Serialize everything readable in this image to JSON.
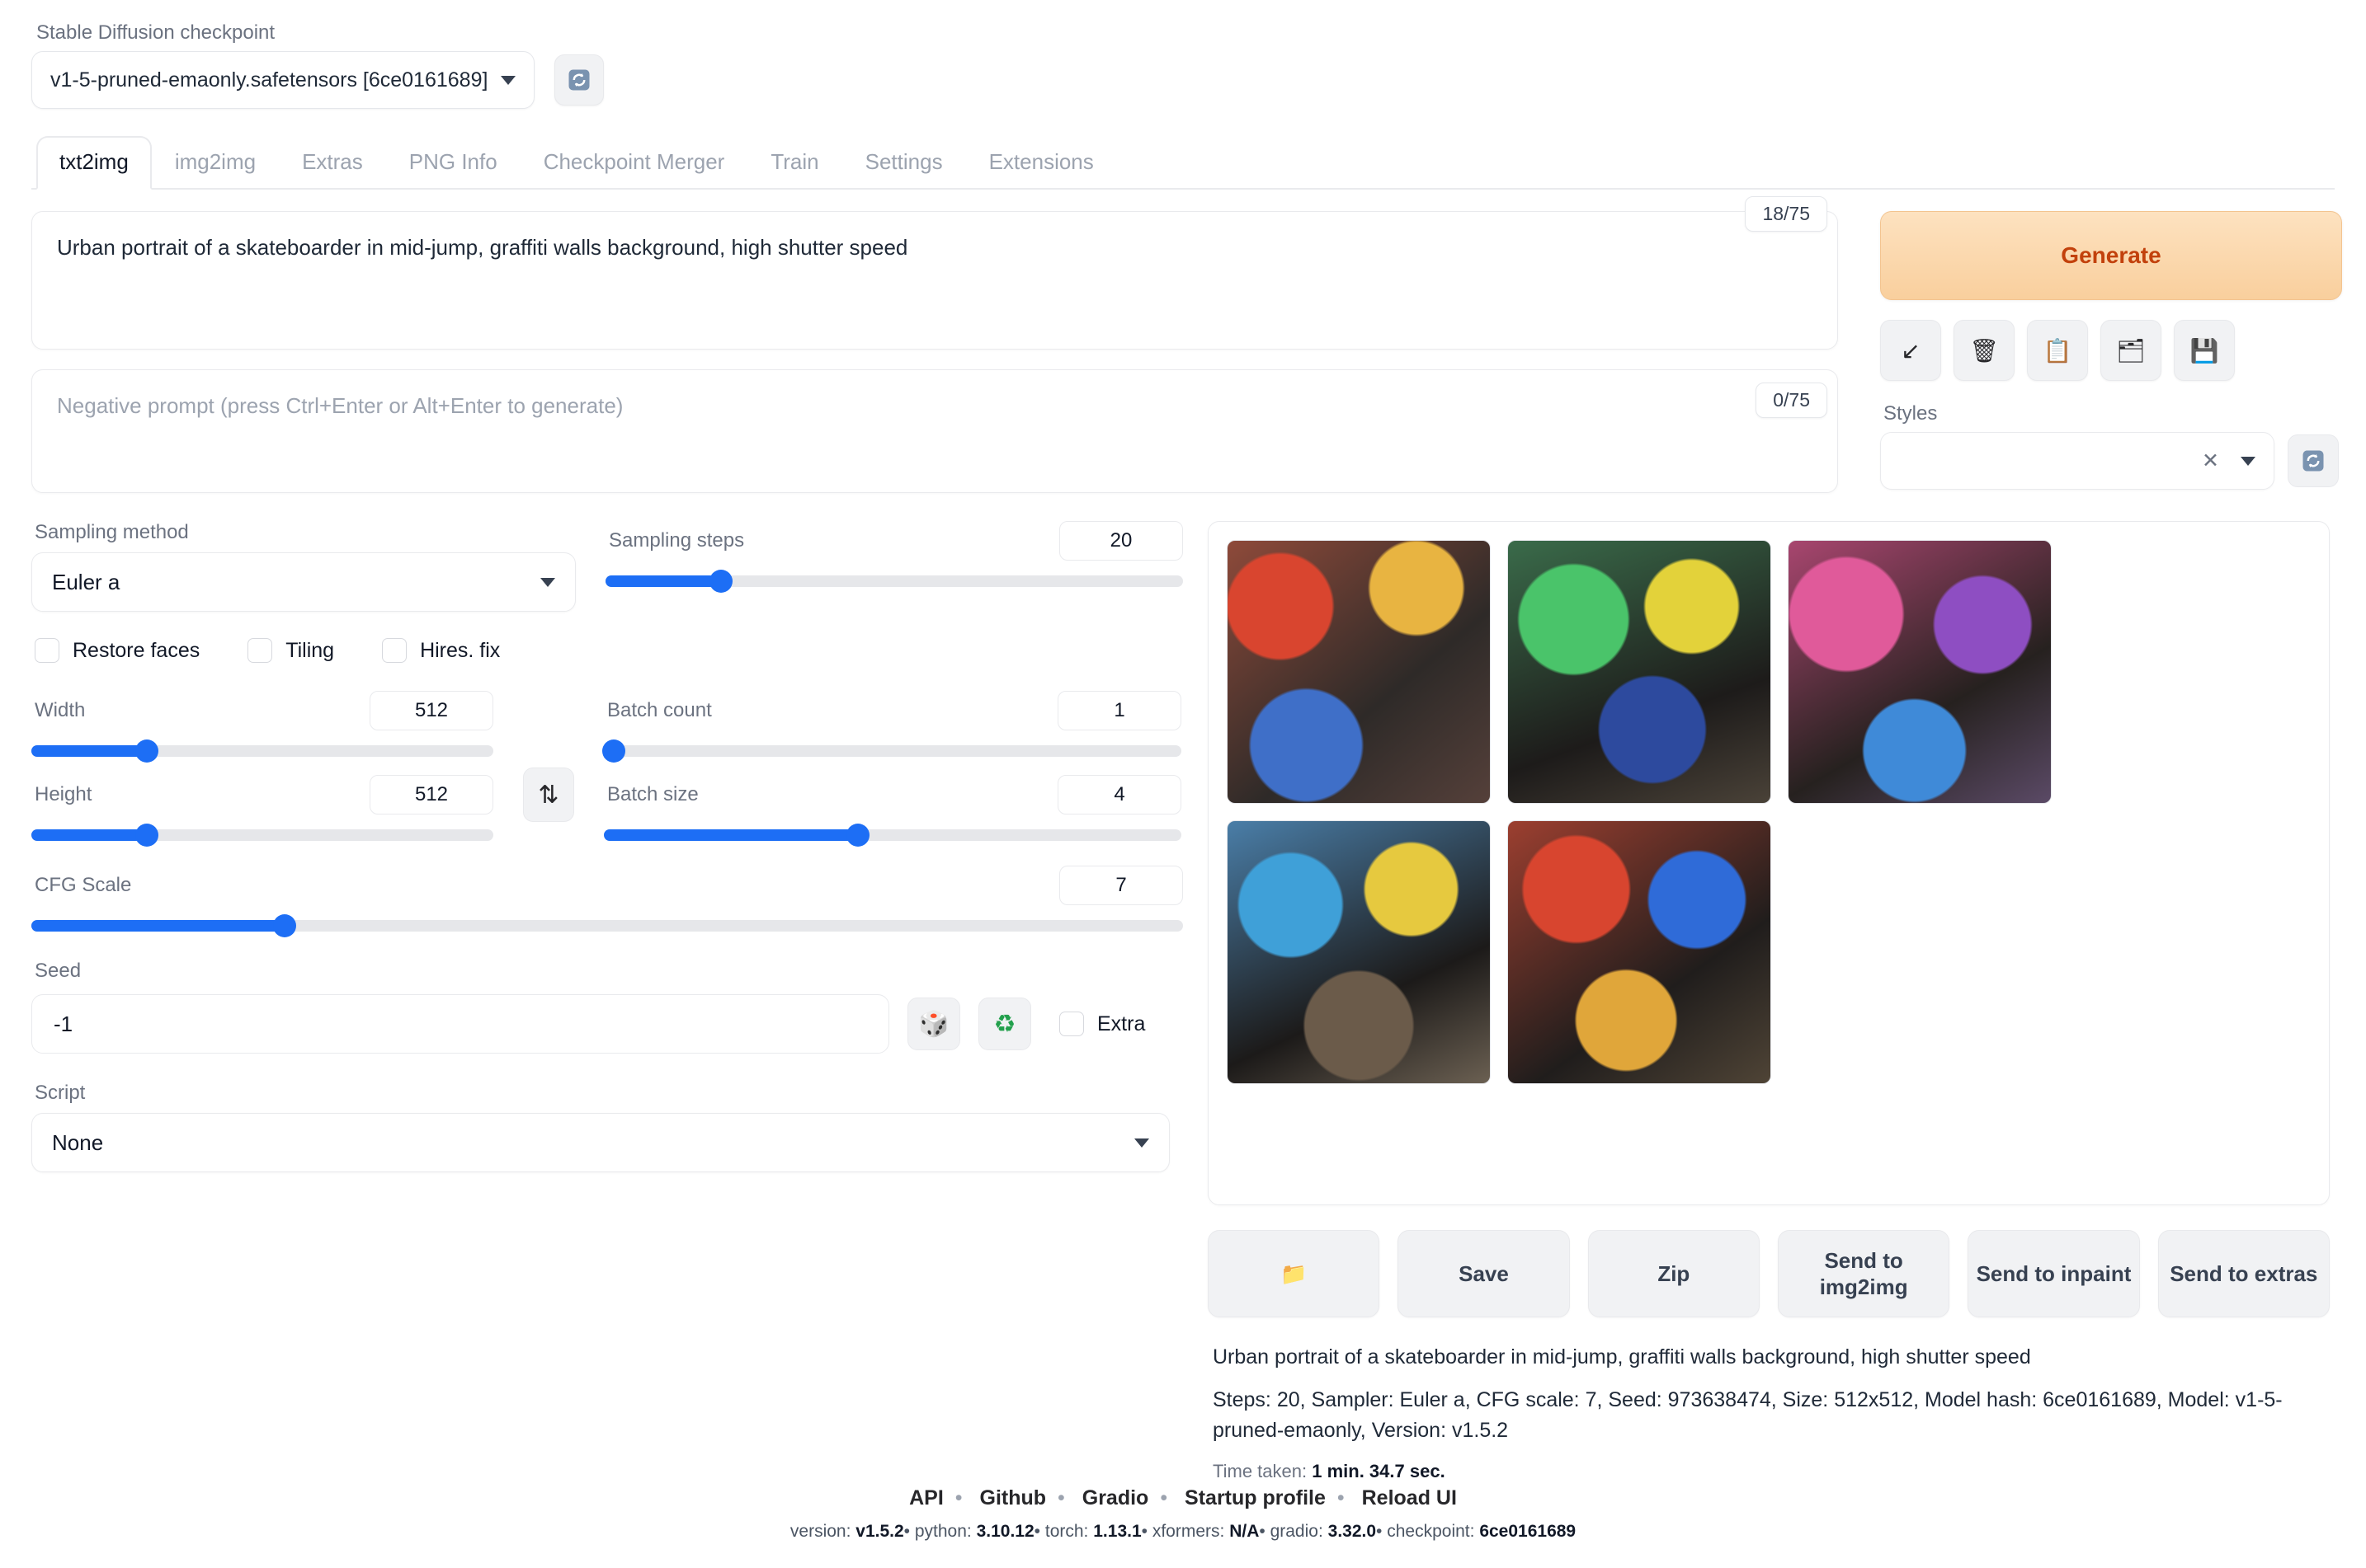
{
  "checkpoint": {
    "label": "Stable Diffusion checkpoint",
    "value": "v1-5-pruned-emaonly.safetensors [6ce0161689]",
    "refresh_icon": "refresh-icon"
  },
  "tabs": [
    {
      "label": "txt2img",
      "active": true
    },
    {
      "label": "img2img",
      "active": false
    },
    {
      "label": "Extras",
      "active": false
    },
    {
      "label": "PNG Info",
      "active": false
    },
    {
      "label": "Checkpoint Merger",
      "active": false
    },
    {
      "label": "Train",
      "active": false
    },
    {
      "label": "Settings",
      "active": false
    },
    {
      "label": "Extensions",
      "active": false
    }
  ],
  "prompt": {
    "value": "Urban portrait of a skateboarder in mid-jump, graffiti walls background, high shutter speed",
    "token_count": "18/75"
  },
  "negative_prompt": {
    "placeholder": "Negative prompt (press Ctrl+Enter or Alt+Enter to generate)",
    "value": "",
    "token_count": "0/75"
  },
  "generate": {
    "label": "Generate",
    "tools": [
      {
        "name": "arrow-down-left-icon",
        "glyph": "↙"
      },
      {
        "name": "trash-icon",
        "glyph": "🗑"
      },
      {
        "name": "paste-icon",
        "glyph": "📋"
      },
      {
        "name": "card-icon",
        "glyph": "🗂"
      },
      {
        "name": "save-style-icon",
        "glyph": "💾"
      }
    ]
  },
  "styles": {
    "label": "Styles",
    "value": "",
    "clear_glyph": "✕",
    "refresh_icon": "refresh-icon"
  },
  "sampling": {
    "method_label": "Sampling method",
    "method_value": "Euler a",
    "steps_label": "Sampling steps",
    "steps_value": "20",
    "steps_percent": 20
  },
  "toggles": [
    {
      "label": "Restore faces",
      "checked": false
    },
    {
      "label": "Tiling",
      "checked": false
    },
    {
      "label": "Hires. fix",
      "checked": false
    }
  ],
  "dimensions": {
    "width_label": "Width",
    "width_value": "512",
    "width_percent": 25,
    "height_label": "Height",
    "height_value": "512",
    "height_percent": 25,
    "swap_glyph": "⇅"
  },
  "batch": {
    "count_label": "Batch count",
    "count_value": "1",
    "count_percent": 0,
    "size_label": "Batch size",
    "size_value": "4",
    "size_percent": 44
  },
  "cfg": {
    "label": "CFG Scale",
    "value": "7",
    "percent": 22
  },
  "seed": {
    "label": "Seed",
    "value": "-1",
    "dice_glyph": "🎲",
    "recycle_glyph": "♻",
    "extra_label": "Extra",
    "extra_checked": false
  },
  "script": {
    "label": "Script",
    "value": "None"
  },
  "gallery": {
    "images": [
      {
        "name": "generated-image-1",
        "colors": [
          "#c84a3c",
          "#e8b441",
          "#4a7ac8",
          "#2e2a28"
        ]
      },
      {
        "name": "generated-image-2",
        "colors": [
          "#4ac46a",
          "#e3d23a",
          "#2d4a9e",
          "#1d1b1a"
        ]
      },
      {
        "name": "generated-image-3",
        "colors": [
          "#e05a9a",
          "#8e4ec2",
          "#3f8ad8",
          "#26211f"
        ]
      },
      {
        "name": "generated-image-4",
        "colors": [
          "#3fa0d8",
          "#e6c93f",
          "#6b5b4a",
          "#1c1a19"
        ]
      },
      {
        "name": "generated-image-5",
        "colors": [
          "#d8452f",
          "#2f6bd8",
          "#e0a63a",
          "#201d1c"
        ]
      }
    ]
  },
  "actions": [
    {
      "name": "open-folder-button",
      "label": "📁"
    },
    {
      "name": "save-button",
      "label": "Save"
    },
    {
      "name": "zip-button",
      "label": "Zip"
    },
    {
      "name": "send-to-img2img-button",
      "label": "Send to img2img"
    },
    {
      "name": "send-to-inpaint-button",
      "label": "Send to inpaint"
    },
    {
      "name": "send-to-extras-button",
      "label": "Send to extras"
    }
  ],
  "generation_info": {
    "prompt": "Urban portrait of a skateboarder in mid-jump, graffiti walls background, high shutter speed",
    "params": "Steps: 20, Sampler: Euler a, CFG scale: 7, Seed: 973638474, Size: 512x512, Model hash: 6ce0161689, Model: v1-5-pruned-emaonly, Version: v1.5.2",
    "time_label": "Time taken:",
    "time_value": "1 min. 34.7 sec."
  },
  "footer": {
    "links": [
      "API",
      "Github",
      "Gradio",
      "Startup profile",
      "Reload UI"
    ],
    "meta": [
      {
        "key": "version:",
        "val": "v1.5.2"
      },
      {
        "key": "python:",
        "val": "3.10.12"
      },
      {
        "key": "torch:",
        "val": "1.13.1"
      },
      {
        "key": "xformers:",
        "val": "N/A"
      },
      {
        "key": "gradio:",
        "val": "3.32.0"
      },
      {
        "key": "checkpoint:",
        "val": "6ce0161689"
      }
    ]
  }
}
